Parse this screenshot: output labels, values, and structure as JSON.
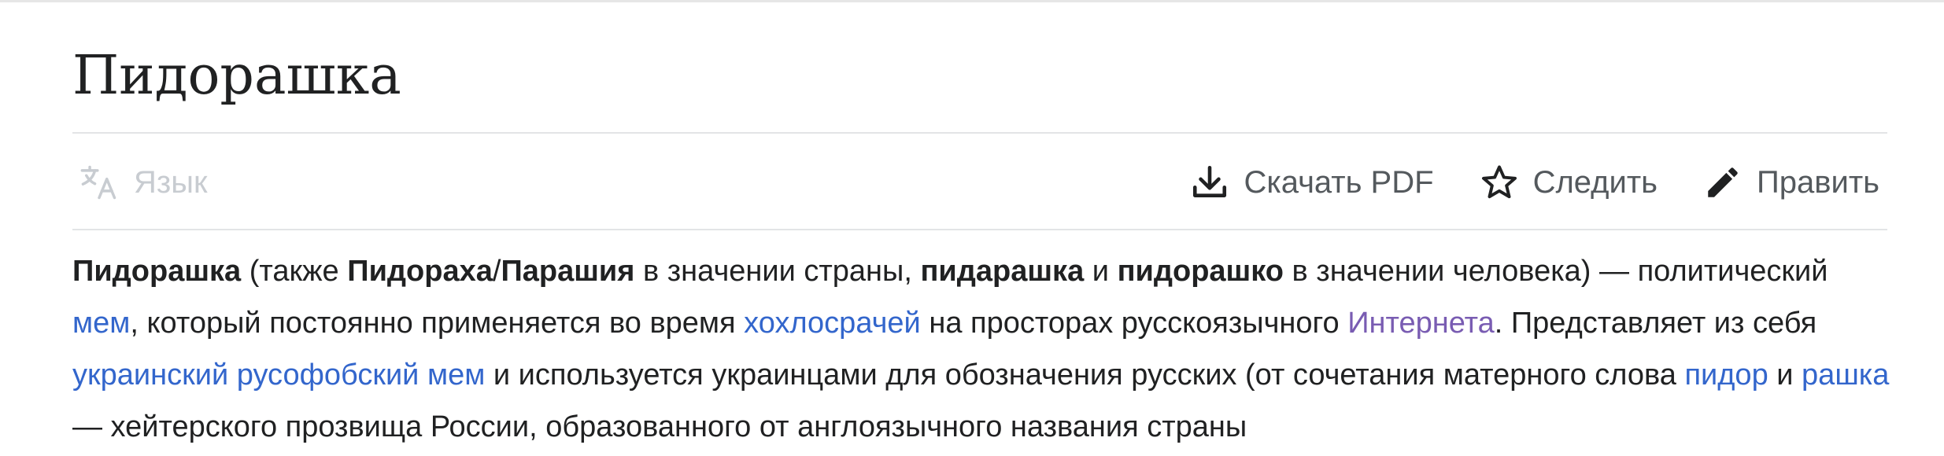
{
  "page": {
    "title": "Пидорашка"
  },
  "toolbar": {
    "language_label": "Язык",
    "language_icon": "translate-icon",
    "download_label": "Скачать PDF",
    "download_icon": "download-icon",
    "watch_label": "Следить",
    "watch_icon": "star-icon",
    "edit_label": "Править",
    "edit_icon": "pencil-icon"
  },
  "colors": {
    "link": "#3366cc",
    "visited_link": "#795cb2",
    "text": "#202122",
    "muted": "#54595d",
    "disabled": "#c8ccd1"
  },
  "article": {
    "s1": "Пидорашка",
    "s2": " (также ",
    "s3": "Пидораха",
    "s4": "/",
    "s5": "Парашия",
    "s6": " в значении страны, ",
    "s7": "пидарашка",
    "s8": " и ",
    "s9": "пидорашко",
    "s10": " в значении человека) — политический ",
    "link_mem": "мем",
    "s11": ", который постоянно применяется во время ",
    "link_holivars": "хохлосрачей",
    "s12": " на просторах русскоязычного ",
    "link_internet": "Интернета",
    "s13": ". Представляет из себя ",
    "link_ukr_meme": "украинский русофобский мем",
    "s14": " и используется украинцами для обозначения русских (от сочетания матерного слова ",
    "link_pidor": "пидор",
    "s15": " и ",
    "link_rashka": "рашка",
    "s16": " — хейтерского прозвища России, образованного от англоязычного названия страны"
  }
}
